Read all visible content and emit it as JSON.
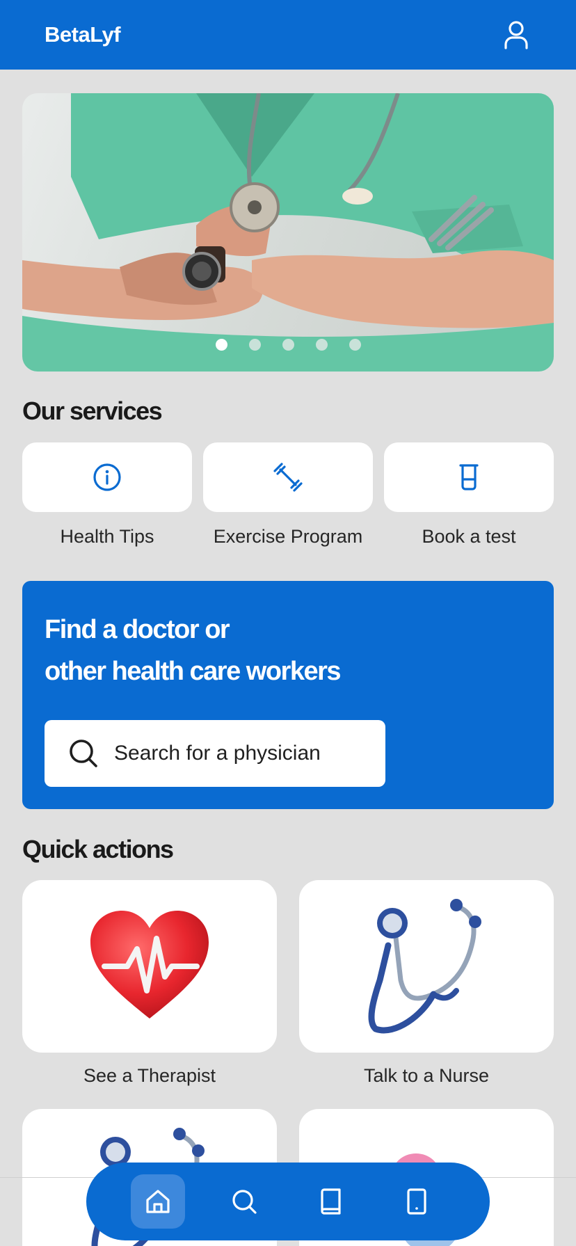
{
  "app": {
    "brand": "BetaLyf"
  },
  "icons": {
    "profile": "user-icon"
  },
  "hero": {
    "slide_count": 5,
    "active_slide": 1
  },
  "services": {
    "title": "Our services",
    "items": [
      {
        "label": "Health Tips",
        "icon": "info-icon"
      },
      {
        "label": "Exercise Program",
        "icon": "dumbbell-icon"
      },
      {
        "label": "Book a test",
        "icon": "test-tube-icon"
      }
    ]
  },
  "finder": {
    "title_line1": "Find a doctor or",
    "title_line2": "other health care workers",
    "search_placeholder": "Search for a physician"
  },
  "quick_actions": {
    "title": "Quick actions",
    "items": [
      {
        "label": "See a Therapist",
        "icon": "heart-pulse-icon"
      },
      {
        "label": "Talk to a Nurse",
        "icon": "stethoscope-icon"
      },
      {
        "label": "",
        "icon": "stethoscope-icon"
      },
      {
        "label": "",
        "icon": "pill-icon"
      }
    ]
  },
  "nav": {
    "items": [
      "home-icon",
      "search-icon",
      "book-icon",
      "tablet-icon"
    ],
    "active": "home-icon"
  },
  "colors": {
    "primary": "#0a6bd1",
    "background": "#e0e0e0",
    "card": "#ffffff"
  }
}
